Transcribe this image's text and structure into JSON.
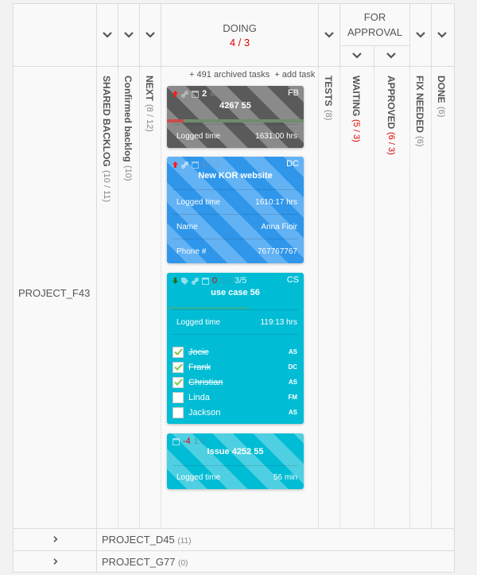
{
  "columns": {
    "shared_backlog": {
      "label": "SHARED BACKLOG",
      "count": "(10 / 11)"
    },
    "confirmed_backlog": {
      "label": "Confirmed backlog",
      "count": "(10)"
    },
    "next": {
      "label": "NEXT",
      "count": "(8 / 12)"
    },
    "doing": {
      "label": "DOING",
      "count": "4 / 3",
      "archived_link": "+ 491 archived tasks",
      "add_link": "+ add task"
    },
    "tests": {
      "label": "TESTS",
      "count": "(8)"
    },
    "for_approval": {
      "label_line1": "FOR",
      "label_line2": "APPROVAL"
    },
    "waiting": {
      "label": "WAITING",
      "count": "(5 / 3)"
    },
    "approved": {
      "label": "APPROVED",
      "count": "(6 / 3)"
    },
    "fix_needed": {
      "label": "FIX NEEDED",
      "count": "(6)"
    },
    "done": {
      "label": "DONE",
      "count": "(6)"
    }
  },
  "projects": [
    {
      "name": "PROJECT_F43",
      "count": ""
    },
    {
      "name": "PROJECT_D45",
      "count": "(11)"
    },
    {
      "name": "PROJECT_G77",
      "count": "(0)"
    }
  ],
  "cards": [
    {
      "title": "4267 55",
      "initials": "FB",
      "priority": "high",
      "subtasks": "2",
      "estimate": "4.0",
      "progress_percent": 12,
      "color": "#5a5a5a",
      "fields": [
        {
          "label": "Logged time",
          "value": "1631:00 hrs"
        }
      ]
    },
    {
      "title": "New KOR website",
      "initials": "DC",
      "priority": "high",
      "subtasks": "1",
      "estimate": "1.0",
      "color": "#2f96ea",
      "fields": [
        {
          "label": "Logged time",
          "value": "1610:17 hrs"
        },
        {
          "label": "Name",
          "value": "Anna Fioir"
        },
        {
          "label": "Phone #",
          "value": "767767767"
        }
      ]
    },
    {
      "title": "use case 56",
      "initials": "CS",
      "priority": "low",
      "due": "0",
      "estimate": "1.0",
      "checklist_count": "3/5",
      "progress_percent": 60,
      "color": "#00bcd4",
      "fields": [
        {
          "label": "Logged time",
          "value": "119:13 hrs"
        }
      ],
      "checklist": [
        {
          "name": "Jocie",
          "initials": "AS",
          "checked": true
        },
        {
          "name": "Frank",
          "initials": "DC",
          "checked": true
        },
        {
          "name": "Christian",
          "initials": "AS",
          "checked": true
        },
        {
          "name": "Linda",
          "initials": "FM",
          "checked": false
        },
        {
          "name": "Jackson",
          "initials": "AS",
          "checked": false
        }
      ]
    },
    {
      "title": "Issue 4252 55",
      "initials": "",
      "due": "-4",
      "estimate": "1.0",
      "color": "#00bcd4",
      "fields": [
        {
          "label": "Logged time",
          "value": "56 min"
        }
      ]
    }
  ],
  "colors": {
    "accent_red": "#e00000",
    "check_green": "#8bc34a"
  }
}
